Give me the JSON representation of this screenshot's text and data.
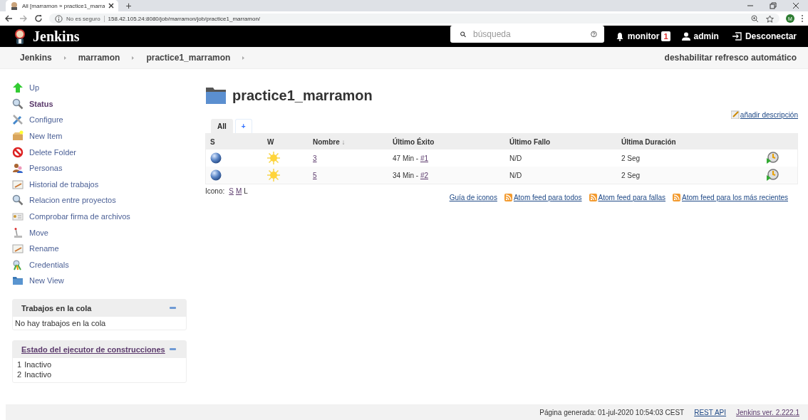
{
  "browser": {
    "tab_title": "All [marramon » practice1_marra",
    "new_tab": "+",
    "security": "No es seguro",
    "url": "158.42.105.24:8080/job/marramon/job/practice1_marramon/",
    "profile": "M"
  },
  "header": {
    "logo": "Jenkins",
    "search": {
      "placeholder": "búsqueda"
    },
    "monitor": "monitor",
    "monitor_count": "1",
    "user": "admin",
    "logout": "Desconectar"
  },
  "breadcrumbs": [
    "Jenkins",
    "marramon",
    "practice1_marramon"
  ],
  "auto_refresh": "deshabilitar refresco automático",
  "sidebar": {
    "items": [
      {
        "label": "Up",
        "selected": false
      },
      {
        "label": "Status",
        "selected": true
      },
      {
        "label": "Configure",
        "selected": false
      },
      {
        "label": "New Item",
        "selected": false
      },
      {
        "label": "Delete Folder",
        "selected": false
      },
      {
        "label": "Personas",
        "selected": false
      },
      {
        "label": "Historial de trabajos",
        "selected": false
      },
      {
        "label": "Relacion entre proyectos",
        "selected": false
      },
      {
        "label": "Comprobar firma de archivos",
        "selected": false
      },
      {
        "label": "Move",
        "selected": false
      },
      {
        "label": "Rename",
        "selected": false
      },
      {
        "label": "Credentials",
        "selected": false
      },
      {
        "label": "New View",
        "selected": false
      }
    ]
  },
  "queue": {
    "title": "Trabajos en la cola",
    "message": "No hay trabajos en la cola"
  },
  "executors": {
    "title": "Estado del ejecutor de construcciones",
    "items": [
      {
        "number": "1",
        "state": "Inactivo"
      },
      {
        "number": "2",
        "state": "Inactivo"
      }
    ]
  },
  "page_title": "practice1_marramon",
  "add_description": "añadir descripción",
  "tabs": [
    {
      "label": "All",
      "selected": true
    },
    {
      "label": "+",
      "selected": false
    }
  ],
  "table": {
    "columns": [
      {
        "label": "S"
      },
      {
        "label": "W"
      },
      {
        "label": "Nombre",
        "sort": "↓"
      },
      {
        "label": "Último Éxito"
      },
      {
        "label": "Último Fallo"
      },
      {
        "label": "Última Duración"
      }
    ],
    "rows": [
      {
        "name": "3",
        "last_success": "47 Min - ",
        "success_build": "#1",
        "last_failure": "N/D",
        "duration": "2 Seg"
      },
      {
        "name": "5",
        "last_success": "34 Min - ",
        "success_build": "#2",
        "last_failure": "N/D",
        "duration": "2 Seg"
      }
    ]
  },
  "icon_size": {
    "label": "Icono:",
    "sizes": [
      {
        "label": "S",
        "selected": false
      },
      {
        "label": "M",
        "selected": false
      },
      {
        "label": "L",
        "selected": true
      }
    ]
  },
  "legend_link": "Guía de iconos",
  "feeds": [
    "Atom feed para todos",
    "Atom feed para fallas",
    "Atom feed para los más recientes"
  ],
  "footer": {
    "generated": "Página generada: 01-jul-2020 10:54:03 CEST",
    "rest_api": "REST API",
    "version": "Jenkins ver. 2.222.1"
  }
}
